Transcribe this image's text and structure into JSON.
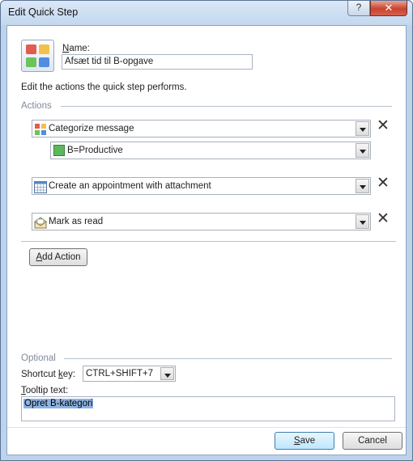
{
  "window": {
    "title": "Edit Quick Step",
    "help_glyph": "?",
    "close_glyph": "✕"
  },
  "name": {
    "label_prefix": "",
    "label_mnemonic": "N",
    "label_rest": "ame:",
    "value": "Afsæt tid til B-opgave"
  },
  "description": "Edit the actions the quick step performs.",
  "actions_section": {
    "label": "Actions",
    "items": [
      {
        "label": "Categorize message",
        "icon": "category-grid-icon"
      },
      {
        "label": "Create an appointment with attachment",
        "icon": "calendar-icon"
      },
      {
        "label": "Mark as read",
        "icon": "open-envelope-icon"
      }
    ],
    "sub_option": {
      "label": "B=Productive",
      "color": "#5cb85c"
    },
    "remove_glyph": "✕",
    "add_action": {
      "mnemonic": "A",
      "rest": "dd Action"
    }
  },
  "optional_section": {
    "label": "Optional",
    "shortcut_label_pre": "Shortcut ",
    "shortcut_mnemonic": "k",
    "shortcut_label_post": "ey:",
    "shortcut_value": "CTRL+SHIFT+7",
    "tooltip_mnemonic": "T",
    "tooltip_label_rest": "ooltip text:",
    "tooltip_value": "Opret B-kategori"
  },
  "footer": {
    "save_mnemonic": "S",
    "save_rest": "ave",
    "cancel_label": "Cancel"
  },
  "colors": {
    "category_red": "#e25b4f",
    "category_yellow": "#f2c14b",
    "category_green": "#6dc35b",
    "category_blue": "#4f8de0",
    "selection": "#8db2e3"
  }
}
